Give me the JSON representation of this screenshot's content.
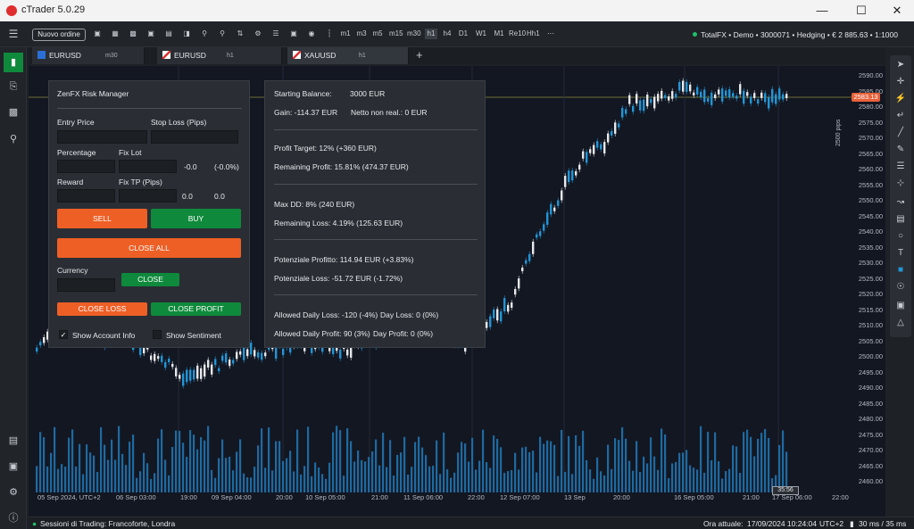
{
  "app": {
    "title": "cTrader 5.0.29"
  },
  "toolbar": {
    "new_order": "Nuovo ordine",
    "timeframes": [
      "m1",
      "m3",
      "m5",
      "m15",
      "m30",
      "h1",
      "h4",
      "D1",
      "W1",
      "M1",
      "Re10",
      "Hh1"
    ],
    "account": "TotalFX • Demo • 3000071 • Hedging • € 2 885.63 • 1:1000"
  },
  "tabs": [
    {
      "symbol": "EURUSD",
      "tf": "m30",
      "active": false
    },
    {
      "symbol": "EURUSD",
      "tf": "h1",
      "active": false
    },
    {
      "symbol": "XAUUSD",
      "tf": "h1",
      "active": true
    }
  ],
  "risk_manager": {
    "title": "ZenFX Risk Manager",
    "entry_price": "Entry Price",
    "stop_loss": "Stop Loss (Pips)",
    "percentage": "Percentage",
    "fix_lot": "Fix Lot",
    "pct_value": "-0.0",
    "pct_display": "(-0.0%)",
    "reward": "Reward",
    "fix_tp": "Fix TP (Pips)",
    "reward_val1": "0.0",
    "reward_val2": "0.0",
    "sell": "SELL",
    "buy": "BUY",
    "close_all": "CLOSE ALL",
    "currency": "Currency",
    "close": "CLOSE",
    "close_loss": "CLOSE LOSS",
    "close_profit": "CLOSE PROFIT",
    "show_account": "Show Account Info",
    "show_sentiment": "Show Sentiment"
  },
  "account_info": {
    "starting_balance_label": "Starting Balance:",
    "starting_balance": "3000 EUR",
    "gain": "Gain: -114.37 EUR",
    "netto": "Netto non real.: 0 EUR",
    "profit_target": "Profit Target: 12% (+360 EUR)",
    "remaining_profit": "Remaining Profit: 15.81%  (474.37 EUR)",
    "max_dd": "Max DD: 8% (240 EUR)",
    "remaining_loss": "Remaining Loss: 4.19% (125.63 EUR)",
    "potenziale_profitto": "Potenziale Profitto: 114.94 EUR (+3.83%)",
    "potenziale_loss": "Potenziale Loss: -51.72 EUR (-1.72%)",
    "allowed_daily_loss": "Allowed Daily Loss: -120 (-4%)",
    "day_loss": "Day Loss: 0 (0%)",
    "allowed_daily_profit": "Allowed Daily Profit: 90 (3%)",
    "day_profit": "Day Profit: 0 (0%)"
  },
  "chart": {
    "price_ticks": [
      "2590.00",
      "2585.00",
      "2580.00",
      "2575.00",
      "2570.00",
      "2565.00",
      "2560.00",
      "2555.00",
      "2550.00",
      "2545.00",
      "2540.00",
      "2535.00",
      "2530.00",
      "2525.00",
      "2520.00",
      "2515.00",
      "2510.00",
      "2505.00",
      "2500.00",
      "2495.00",
      "2490.00",
      "2485.00",
      "2480.00",
      "2475.00",
      "2470.00",
      "2465.00",
      "2460.00"
    ],
    "current_price": "2583.13",
    "pips_label": "2500 pips",
    "time_labels": [
      "05 Sep 2024, UTC+2",
      "06 Sep 03:00",
      "19:00",
      "09 Sep 04:00",
      "20:00",
      "10 Sep 05:00",
      "21:00",
      "11 Sep 06:00",
      "22:00",
      "12 Sep 07:00",
      "13 Sep",
      "20:00",
      "16 Sep 05:00",
      "21:00",
      "17 Sep 06:00",
      "22:00"
    ],
    "time_tag": "35:56",
    "bull_color": "#2196d6",
    "bear_color": "#e6e8eb"
  },
  "statusbar": {
    "sessions": "Sessioni di Trading: Francoforte, Londra",
    "time_label": "Ora attuale:",
    "time": "17/09/2024 10:24:04",
    "tz": "UTC+2",
    "latency": "30 ms / 35 ms"
  }
}
